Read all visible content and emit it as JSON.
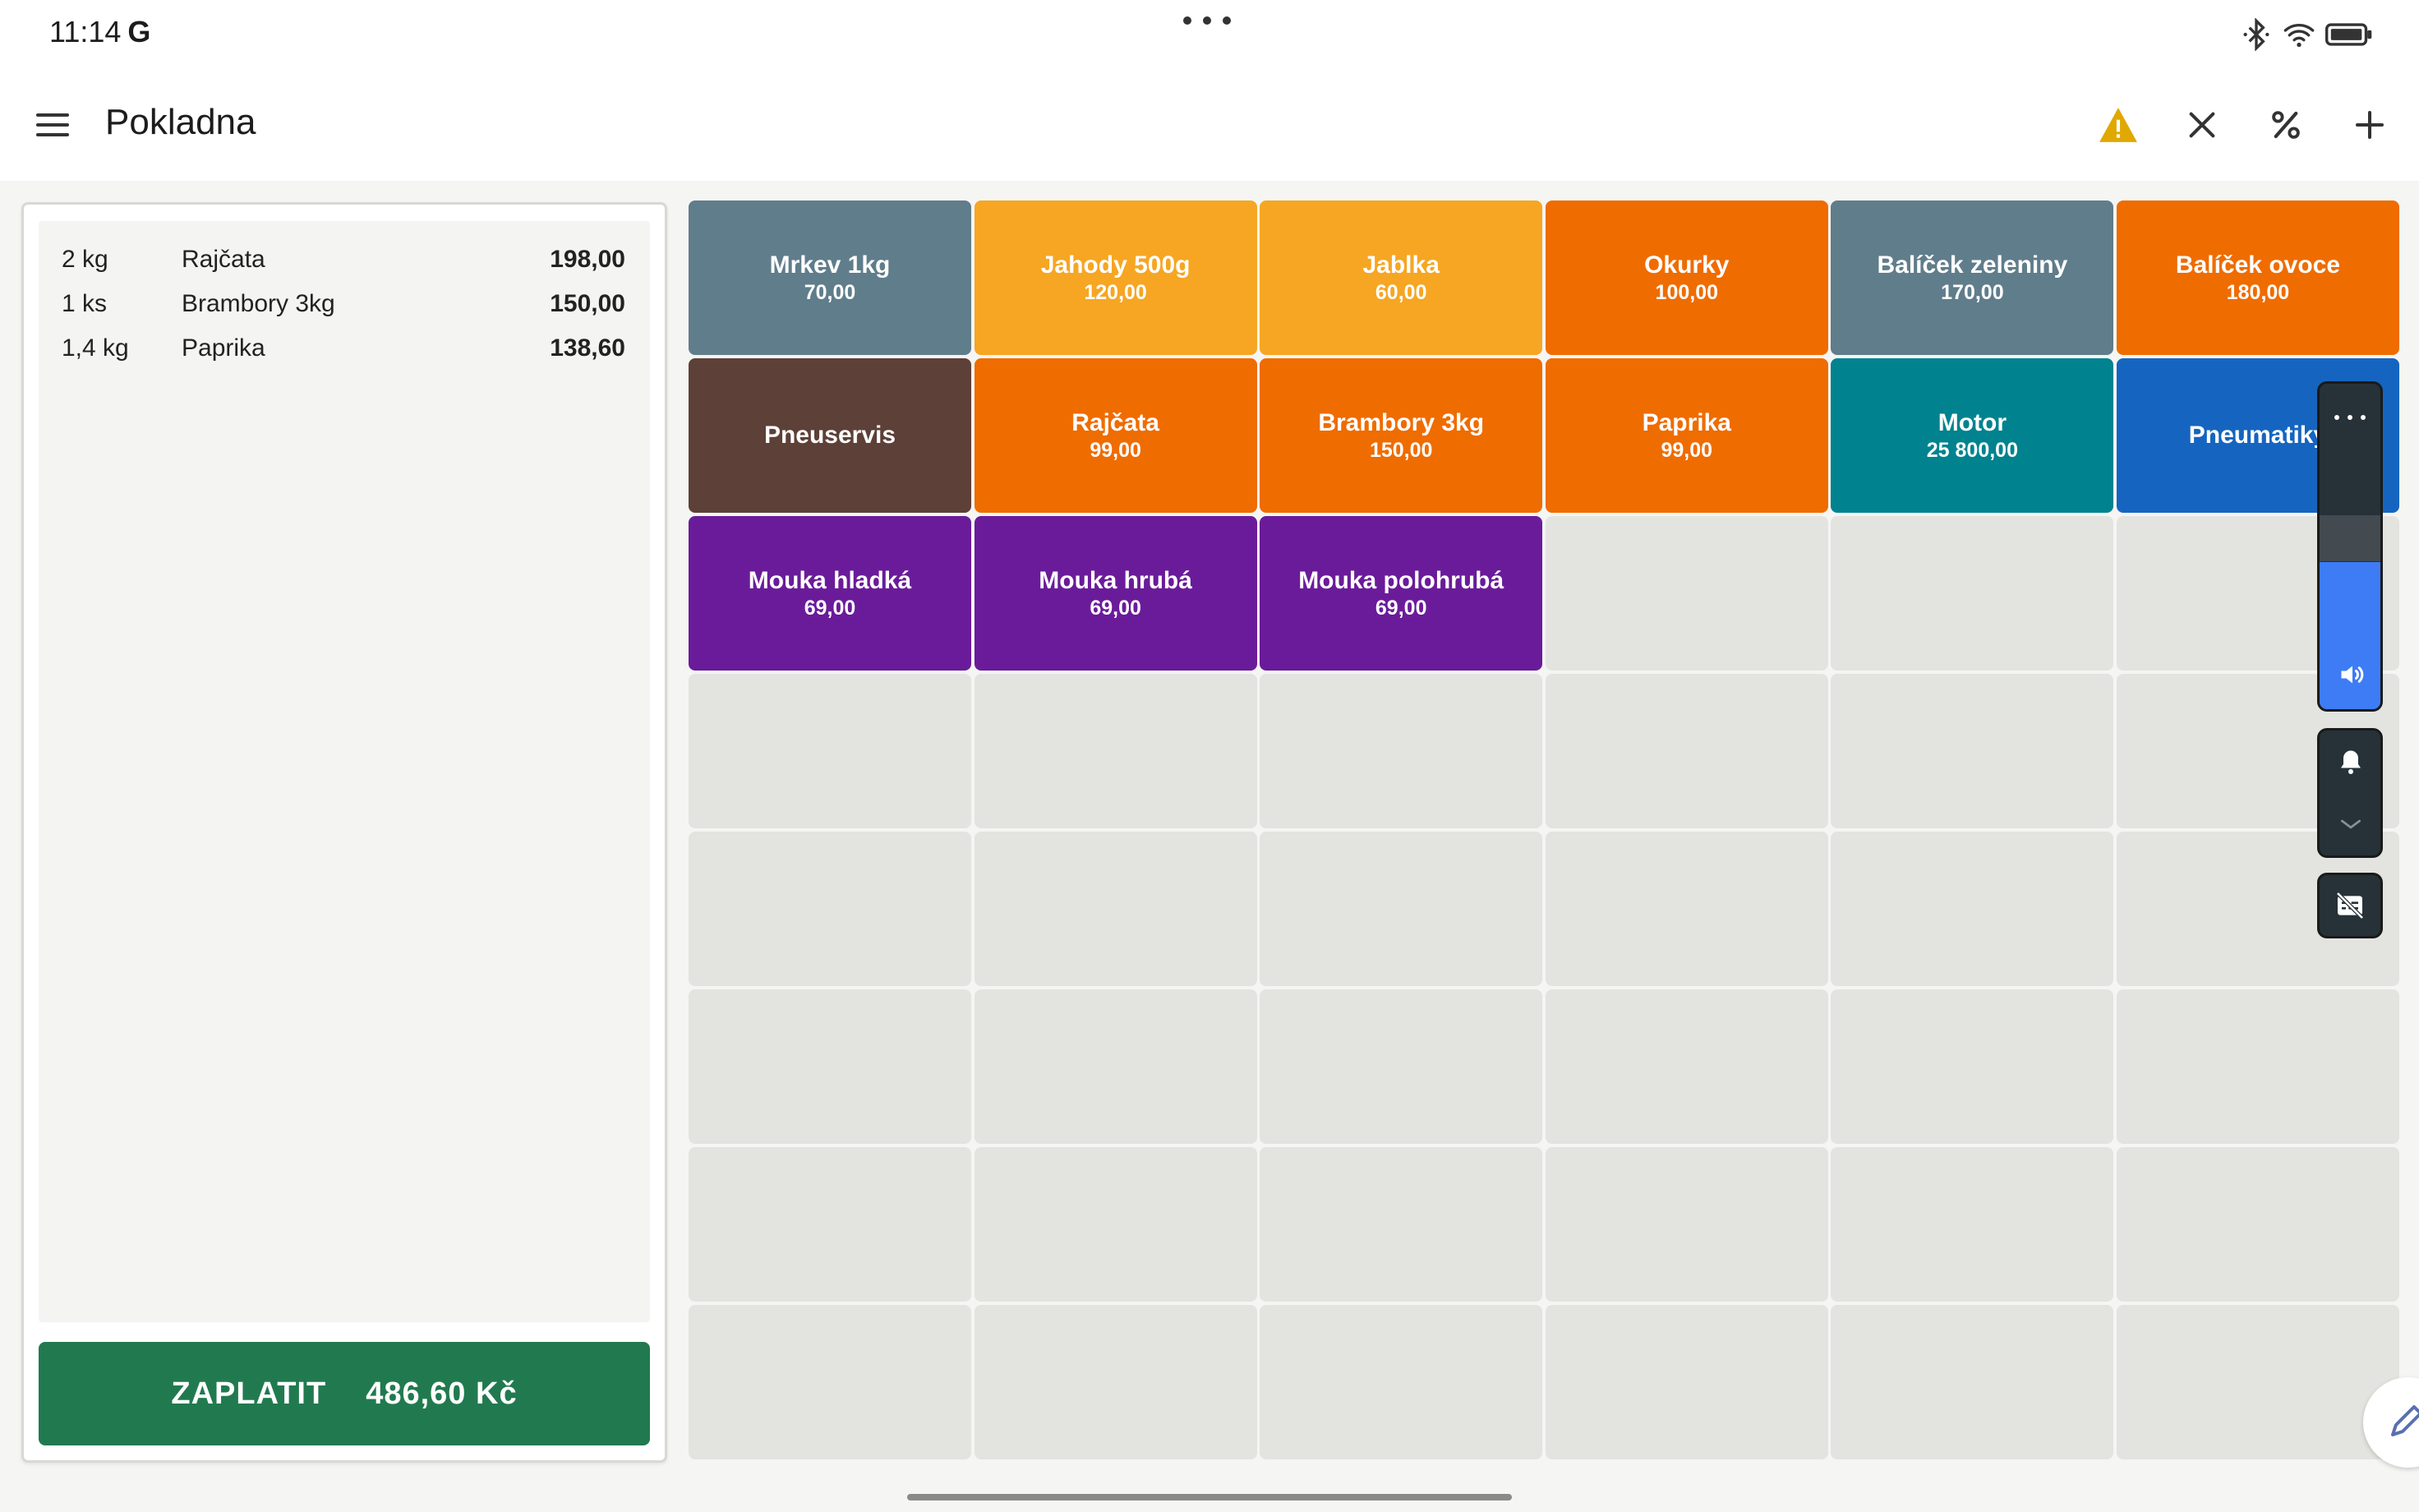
{
  "status_bar": {
    "time": "11:14",
    "carrier_glyph": "G"
  },
  "app": {
    "title": "Pokladna"
  },
  "toolbar": {
    "icons": [
      "menu-icon",
      "warning-icon",
      "close-icon",
      "percent-icon",
      "add-icon"
    ],
    "warning_color": "#e0a800"
  },
  "receipt": {
    "items": [
      {
        "qty": "2 kg",
        "name": "Rajčata",
        "price": "198,00"
      },
      {
        "qty": "1 ks",
        "name": "Brambory 3kg",
        "price": "150,00"
      },
      {
        "qty": "1,4 kg",
        "name": "Paprika",
        "price": "138,60"
      }
    ],
    "pay_label": "ZAPLATIT",
    "total": "486,60 Kč",
    "pay_color": "#217a4f"
  },
  "products": [
    {
      "name": "Mrkev 1kg",
      "price": "70,00",
      "color": "#607d8b"
    },
    {
      "name": "Jahody 500g",
      "price": "120,00",
      "color": "#f6a623"
    },
    {
      "name": "Jablka",
      "price": "60,00",
      "color": "#f6a623"
    },
    {
      "name": "Okurky",
      "price": "100,00",
      "color": "#ef6c00"
    },
    {
      "name": "Balíček zeleniny",
      "price": "170,00",
      "color": "#607d8b"
    },
    {
      "name": "Balíček ovoce",
      "price": "180,00",
      "color": "#ef6c00"
    },
    {
      "name": "Pneuservis",
      "price": "",
      "color": "#5d4037"
    },
    {
      "name": "Rajčata",
      "price": "99,00",
      "color": "#ef6c00"
    },
    {
      "name": "Brambory 3kg",
      "price": "150,00",
      "color": "#ef6c00"
    },
    {
      "name": "Paprika",
      "price": "99,00",
      "color": "#ef6c00"
    },
    {
      "name": "Motor",
      "price": "25 800,00",
      "color": "#00838f"
    },
    {
      "name": "Pneumatiky",
      "price": "",
      "color": "#1565c0"
    },
    {
      "name": "Mouka hladká",
      "price": "69,00",
      "color": "#6a1b9a"
    },
    {
      "name": "Mouka hrubá",
      "price": "69,00",
      "color": "#6a1b9a"
    },
    {
      "name": "Mouka polohrubá",
      "price": "69,00",
      "color": "#6a1b9a"
    }
  ],
  "grid": {
    "empty_tile_color": "#e3e4df",
    "total_tiles": 48
  },
  "volume_panel": {
    "level_fraction": 0.46,
    "accent": "#3d7cf5"
  }
}
